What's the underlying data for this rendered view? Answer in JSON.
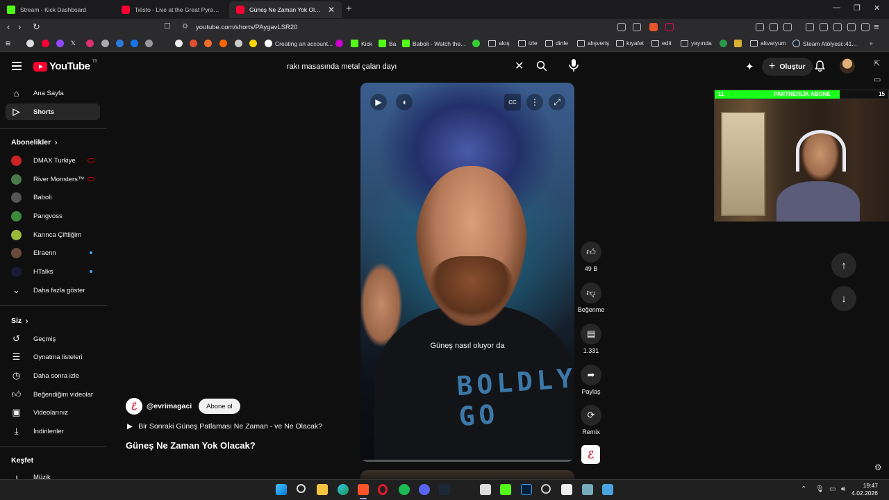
{
  "browser": {
    "tabs": [
      {
        "title": "Stream - Kick Dashboard",
        "icon": "kick-icon"
      },
      {
        "title": "Tiësto - Live at the Great Pyramids of Giza",
        "icon": "youtube-icon"
      },
      {
        "title": "Güneş Ne Zaman Yok Olacak? - YouTube",
        "icon": "youtube-icon"
      }
    ],
    "url": "youtube.com/shorts/PAygavLSR20",
    "bookmarks": [
      {
        "label": "Creating an account...",
        "type": "link"
      },
      {
        "label": "Kick",
        "type": "link"
      },
      {
        "label": "Ba",
        "type": "link"
      },
      {
        "label": "Baboli - Watch the...",
        "type": "link"
      },
      {
        "label": "akış",
        "type": "folder"
      },
      {
        "label": "izle",
        "type": "folder"
      },
      {
        "label": "dinle",
        "type": "folder"
      },
      {
        "label": "alışveriş",
        "type": "folder"
      },
      {
        "label": "kıyafet",
        "type": "folder"
      },
      {
        "label": "edit",
        "type": "folder"
      },
      {
        "label": "yayında",
        "type": "folder"
      },
      {
        "label": "akvaryum",
        "type": "folder"
      },
      {
        "label": "Steam Atölyesi::41...",
        "type": "link"
      }
    ]
  },
  "header": {
    "logo_text": "YouTube",
    "logo_region": "TR",
    "search_value": "rakı masasında metal çalan dayı",
    "create_label": "Oluştur"
  },
  "sidebar": {
    "main": [
      {
        "label": "Ana Sayfa",
        "icon": "home-icon"
      },
      {
        "label": "Shorts",
        "icon": "shorts-icon",
        "active": true
      }
    ],
    "subscriptions_heading": "Abonelikler",
    "subscriptions": [
      {
        "label": "DMAX Turkiye",
        "status": "live",
        "color": "#cc2222"
      },
      {
        "label": "River Monsters™",
        "status": "live",
        "color": "#4a7a4a"
      },
      {
        "label": "Baboli",
        "status": "",
        "color": "#555555"
      },
      {
        "label": "Pangvoss",
        "status": "",
        "color": "#3a8a3a"
      },
      {
        "label": "Karınca Çiftliğim",
        "status": "",
        "color": "#9ab83a"
      },
      {
        "label": "Elraenn",
        "status": "new",
        "color": "#6a4a3a"
      },
      {
        "label": "HTalks",
        "status": "new",
        "color": "#1a1a3a"
      }
    ],
    "show_more": "Daha fazla göster",
    "you_heading": "Siz",
    "you_items": [
      {
        "label": "Geçmiş",
        "icon": "history-icon"
      },
      {
        "label": "Oynatma listeleri",
        "icon": "playlist-icon"
      },
      {
        "label": "Daha sonra izle",
        "icon": "clock-icon"
      },
      {
        "label": "Beğendiğim videolar",
        "icon": "like-icon"
      },
      {
        "label": "Videolarınız",
        "icon": "video-icon"
      },
      {
        "label": "İndirilenler",
        "icon": "download-icon"
      }
    ],
    "explore_heading": "Keşfet",
    "explore_items": [
      {
        "label": "Müzik",
        "icon": "music-icon"
      }
    ]
  },
  "short": {
    "caption": "Güneş nasıl oluyor da",
    "overlay_text": "BOLDLY GO",
    "channel": "@evrimagaci",
    "subscribe_label": "Abone ol",
    "related": "Bir Sonraki Güneş Patlaması Ne Zaman - ve Ne Olacak?",
    "title": "Güneş Ne Zaman Yok Olacak?",
    "likes": "49 B",
    "dislike_label": "Beğenme",
    "comments": "1.331",
    "share_label": "Paylaş",
    "remix_label": "Remix"
  },
  "stream_overlay": {
    "left_count": "11",
    "label": "PARTNERLİK ABONE",
    "right_count": "15",
    "progress": 0.72
  },
  "taskbar": {
    "time": "19:47",
    "date": "4.02.2026"
  }
}
